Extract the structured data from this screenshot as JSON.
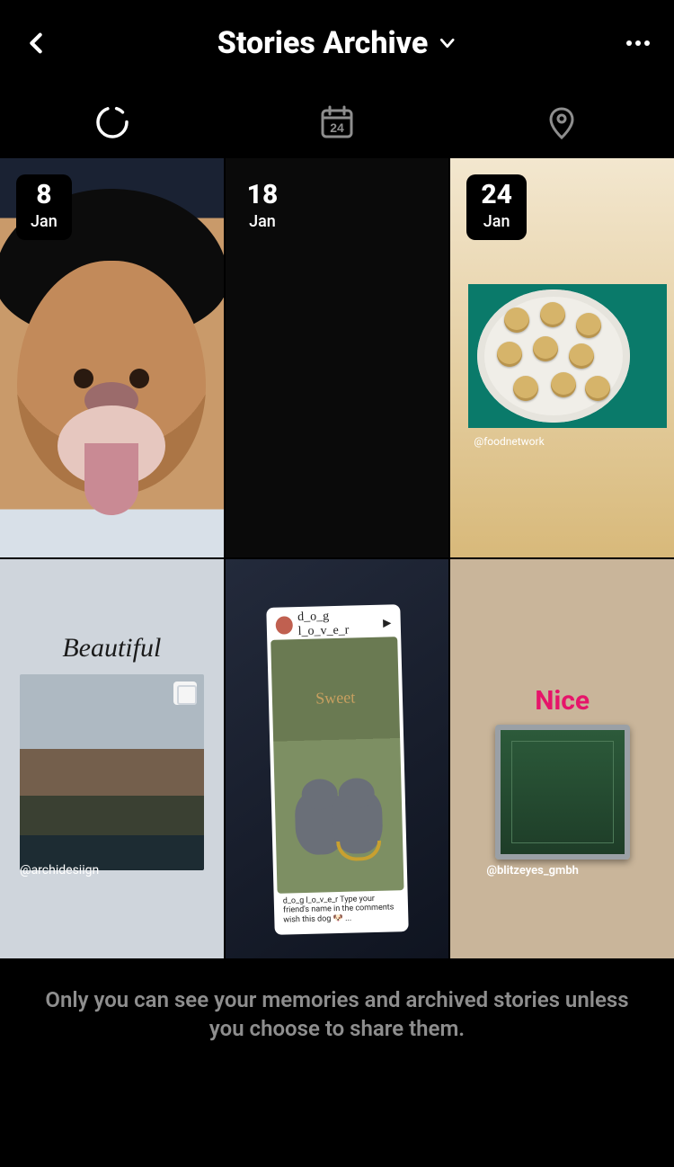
{
  "header": {
    "title": "Stories Archive"
  },
  "tabs": {
    "stories_icon": "stories-ring-icon",
    "calendar_day": "24",
    "location_icon": "location-pin-icon"
  },
  "stories": [
    {
      "day": "8",
      "month": "Jan",
      "badge_style": "solid"
    },
    {
      "day": "18",
      "month": "Jan",
      "badge_style": "transparent"
    },
    {
      "day": "24",
      "month": "Jan",
      "badge_style": "solid",
      "credit": "@foodnetwork"
    },
    {
      "caption": "Beautiful",
      "credit": "@archidesiign"
    },
    {
      "caption": "Sweet",
      "repost_user": "d_o_g l_o_v_e_r",
      "repost_caption": "d_o_g l_o_v_e_r  Type your friend's name in the comments wish this dog 🐶 ..."
    },
    {
      "caption": "Nice",
      "credit": "@blitzeyes_gmbh"
    }
  ],
  "footer": {
    "note": "Only you can see your memories and archived stories unless you choose to share them."
  }
}
